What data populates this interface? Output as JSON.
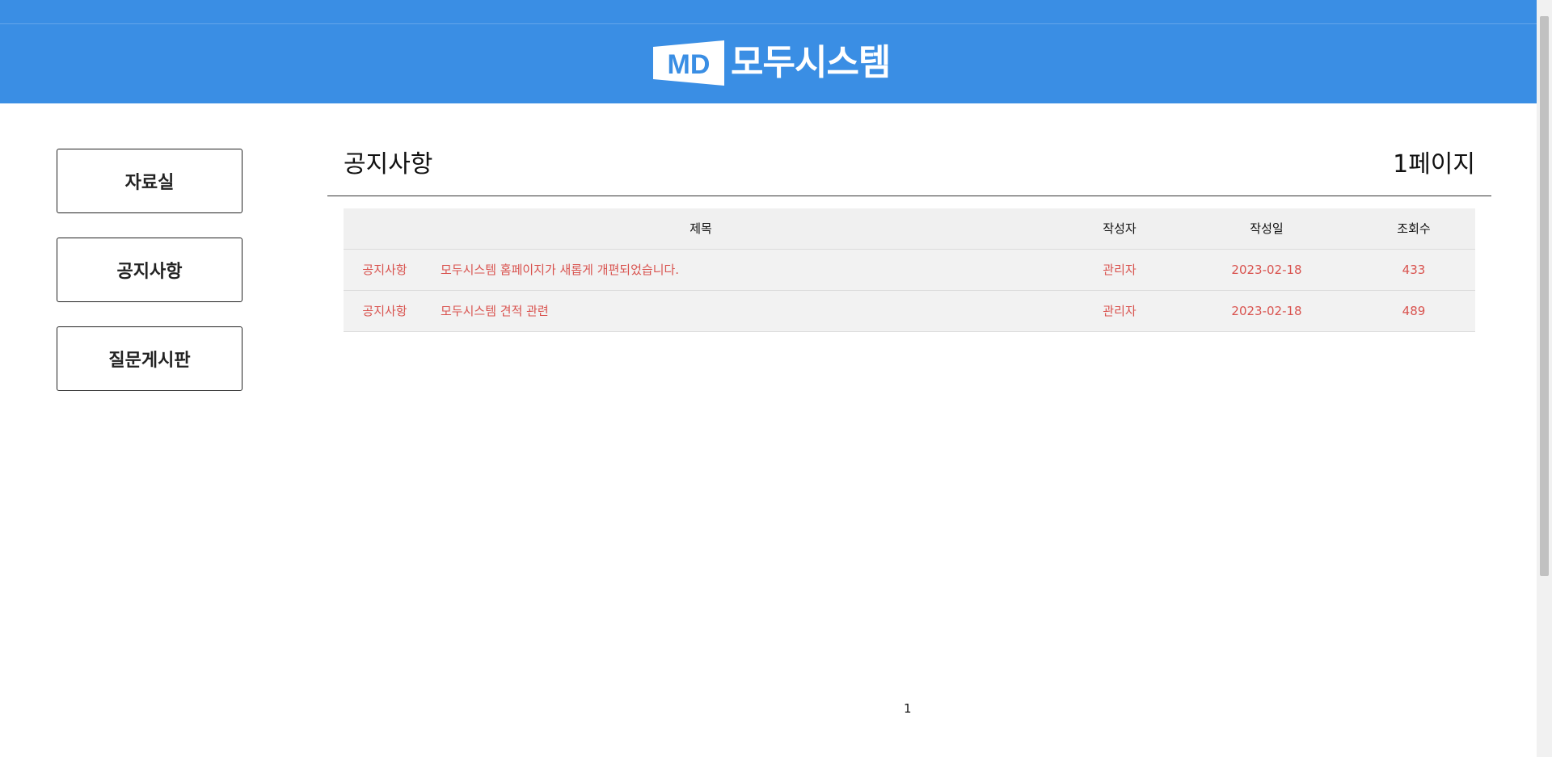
{
  "header": {
    "logo_mark": "MD",
    "logo_text": "모두시스템",
    "background_color": "#3a8ee4"
  },
  "sidebar": {
    "items": [
      {
        "label": "자료실"
      },
      {
        "label": "공지사항"
      },
      {
        "label": "질문게시판"
      }
    ]
  },
  "board": {
    "title": "공지사항",
    "page_label": "1페이지",
    "columns": {
      "subject": "제목",
      "author": "작성자",
      "date": "작성일",
      "views": "조회수"
    },
    "rows": [
      {
        "category": "공지사항",
        "subject": "모두시스템 홈페이지가 새롭게 개편되었습니다.",
        "author": "관리자",
        "date": "2023-02-18",
        "views": "433"
      },
      {
        "category": "공지사항",
        "subject": "모두시스템 견적 관련",
        "author": "관리자",
        "date": "2023-02-18",
        "views": "489"
      }
    ],
    "row_text_color": "#d9534f"
  },
  "pagination": {
    "pages": [
      "1"
    ]
  }
}
